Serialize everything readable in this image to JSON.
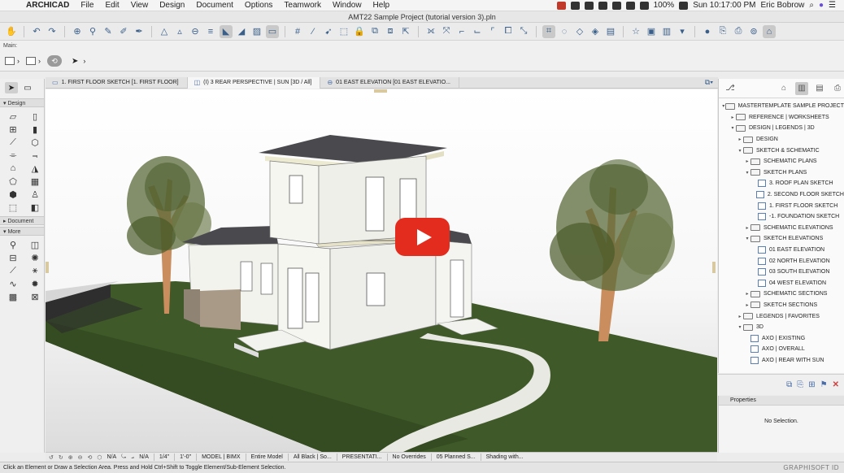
{
  "menubar": {
    "app_name": "ARCHICAD",
    "items": [
      "File",
      "Edit",
      "View",
      "Design",
      "Document",
      "Options",
      "Teamwork",
      "Window",
      "Help"
    ],
    "battery": "100%",
    "clock": "Sun 10:17:00 PM",
    "user": "Eric Bobrow"
  },
  "window": {
    "title": "AMT22 Sample Project (tutorial version 3).pln"
  },
  "infobox": {
    "main_label": "Main:"
  },
  "toolbox": {
    "sections": {
      "design": "Design",
      "document": "Document",
      "more": "More"
    }
  },
  "tabs": [
    {
      "label": "1. FIRST FLOOR SKETCH [1. FIRST FLOOR]",
      "icon": "floorplan-icon"
    },
    {
      "label": "(I) 3 REAR PERSPECTIVE | SUN [3D / All]",
      "icon": "camera-icon"
    },
    {
      "label": "01 EAST ELEVATION [01 EAST ELEVATIO...",
      "icon": "elevation-icon"
    }
  ],
  "navigator": {
    "tree": [
      {
        "label": "MASTERTEMPLATE SAMPLE PROJECT",
        "level": 0,
        "twisty": "▾",
        "kind": "project"
      },
      {
        "label": "REFERENCE | WORKSHEETS",
        "level": 1,
        "twisty": "▸",
        "kind": "folder"
      },
      {
        "label": "DESIGN | LEGENDS | 3D",
        "level": 1,
        "twisty": "▾",
        "kind": "folder"
      },
      {
        "label": "DESIGN",
        "level": 2,
        "twisty": "▸",
        "kind": "folder"
      },
      {
        "label": "SKETCH & SCHEMATIC",
        "level": 2,
        "twisty": "▾",
        "kind": "folder"
      },
      {
        "label": "SCHEMATIC PLANS",
        "level": 3,
        "twisty": "▸",
        "kind": "folder"
      },
      {
        "label": "SKETCH PLANS",
        "level": 3,
        "twisty": "▾",
        "kind": "folder"
      },
      {
        "label": "3. ROOF PLAN SKETCH",
        "level": 4,
        "twisty": "",
        "kind": "view"
      },
      {
        "label": "2. SECOND FLOOR SKETCH",
        "level": 4,
        "twisty": "",
        "kind": "view"
      },
      {
        "label": "1. FIRST FLOOR SKETCH",
        "level": 4,
        "twisty": "",
        "kind": "view"
      },
      {
        "label": "-1. FOUNDATION SKETCH",
        "level": 4,
        "twisty": "",
        "kind": "view"
      },
      {
        "label": "SCHEMATIC ELEVATIONS",
        "level": 3,
        "twisty": "▸",
        "kind": "folder"
      },
      {
        "label": "SKETCH ELEVATIONS",
        "level": 3,
        "twisty": "▾",
        "kind": "folder"
      },
      {
        "label": "01 EAST ELEVATION",
        "level": 4,
        "twisty": "",
        "kind": "view"
      },
      {
        "label": "02 NORTH ELEVATION",
        "level": 4,
        "twisty": "",
        "kind": "view"
      },
      {
        "label": "03 SOUTH ELEVATION",
        "level": 4,
        "twisty": "",
        "kind": "view"
      },
      {
        "label": "04 WEST ELEVATION",
        "level": 4,
        "twisty": "",
        "kind": "view"
      },
      {
        "label": "SCHEMATIC SECTIONS",
        "level": 3,
        "twisty": "▸",
        "kind": "folder"
      },
      {
        "label": "SKETCH SECTIONS",
        "level": 3,
        "twisty": "▸",
        "kind": "folder"
      },
      {
        "label": "LEGENDS | FAVORITES",
        "level": 2,
        "twisty": "▸",
        "kind": "folder"
      },
      {
        "label": "3D",
        "level": 2,
        "twisty": "▾",
        "kind": "folder"
      },
      {
        "label": "AXO | EXISTING",
        "level": 3,
        "twisty": "",
        "kind": "view"
      },
      {
        "label": "AXO | OVERALL",
        "level": 3,
        "twisty": "",
        "kind": "view"
      },
      {
        "label": "AXO | REAR WITH SUN",
        "level": 3,
        "twisty": "",
        "kind": "view"
      }
    ]
  },
  "properties": {
    "title": "Properties",
    "empty": "No Selection."
  },
  "quickbar": {
    "zoom_a": "N/A",
    "zoom_b": "N/A",
    "scale": "1/4\"",
    "dim": "1'-0\"",
    "layer": "MODEL | BIMX",
    "model": "Entire Model",
    "pen": "All Black | So...",
    "graphic": "PRESENTATI...",
    "overrides": "No Overrides",
    "phase": "05 Planned S...",
    "shading": "Shading with..."
  },
  "status": {
    "hint": "Click an Element or Draw a Selection Area. Press and Hold Ctrl+Shift to Toggle Element/Sub-Element Selection.",
    "brand": "GRAPHISOFT ID"
  },
  "colors": {
    "grass": "#3f5a28",
    "play": "#e32c1e",
    "wall": "#f6f6f1",
    "roof": "#4a4a4e"
  }
}
